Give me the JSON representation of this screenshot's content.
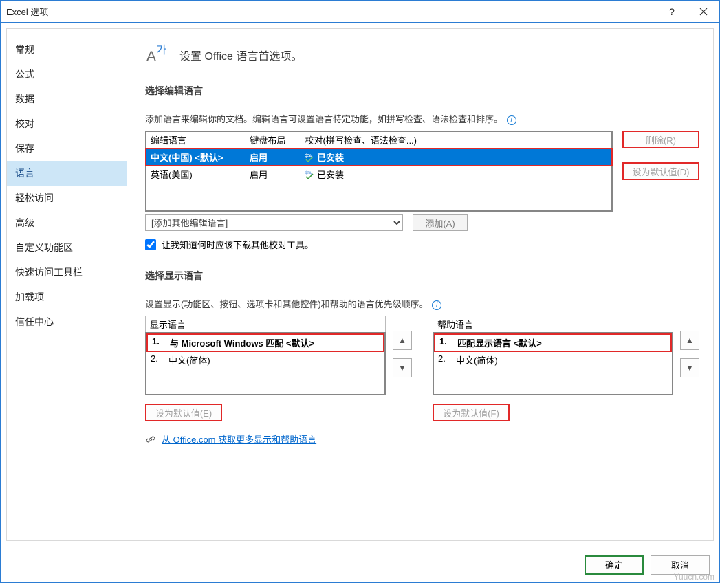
{
  "title": "Excel 选项",
  "sidebar": {
    "items": [
      "常规",
      "公式",
      "数据",
      "校对",
      "保存",
      "语言",
      "轻松访问",
      "高级",
      "自定义功能区",
      "快速访问工具栏",
      "加载项",
      "信任中心"
    ],
    "active": 5
  },
  "header": {
    "text": "设置 Office 语言首选项。"
  },
  "section_edit": {
    "title": "选择编辑语言",
    "desc": "添加语言来编辑你的文档。编辑语言可设置语言特定功能，如拼写检查、语法检查和排序。",
    "columns": [
      "编辑语言",
      "键盘布局",
      "校对(拼写检查、语法检查...)"
    ],
    "rows": [
      {
        "lang": "中文(中国) <默认>",
        "keyboard": "启用",
        "proof": "已安装",
        "selected": true
      },
      {
        "lang": "英语(美国)",
        "keyboard": "启用",
        "proof": "已安装",
        "selected": false
      }
    ],
    "btn_remove": "删除(R)",
    "btn_default": "设为默认值(D)",
    "add_placeholder": "[添加其他编辑语言]",
    "btn_add": "添加(A)",
    "check_label": "让我知道何时应该下载其他校对工具。"
  },
  "section_display": {
    "title": "选择显示语言",
    "desc": "设置显示(功能区、按钮、选项卡和其他控件)和帮助的语言优先级顺序。",
    "left": {
      "header": "显示语言",
      "items": [
        {
          "num": "1.",
          "text": "与 Microsoft Windows 匹配 <默认>",
          "selected": true
        },
        {
          "num": "2.",
          "text": "中文(简体)",
          "selected": false
        }
      ],
      "btn_default": "设为默认值(E)"
    },
    "right": {
      "header": "帮助语言",
      "items": [
        {
          "num": "1.",
          "text": "匹配显示语言 <默认>",
          "selected": true
        },
        {
          "num": "2.",
          "text": "中文(简体)",
          "selected": false
        }
      ],
      "btn_default": "设为默认值(F)"
    },
    "link": "从 Office.com 获取更多显示和帮助语言"
  },
  "footer": {
    "ok": "确定",
    "cancel": "取消"
  },
  "watermark": "Yuucn.com"
}
